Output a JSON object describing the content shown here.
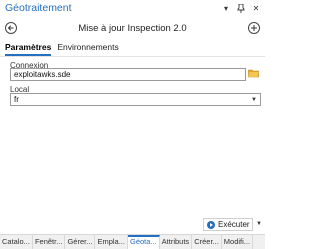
{
  "window": {
    "title": "Géotraitement"
  },
  "title_icons": [
    "dropdown-arrow-icon",
    "pin-icon",
    "close-icon"
  ],
  "tool": {
    "title": "Mise à jour Inspection 2.0"
  },
  "tabs": [
    {
      "label": "Paramètres",
      "active": true
    },
    {
      "label": "Environnements",
      "active": false
    }
  ],
  "params": {
    "connexion": {
      "label": "Connexion",
      "value": "exploitawks.sde"
    },
    "local": {
      "label": "Local",
      "value": "fr"
    }
  },
  "run": {
    "label": "Exécuter"
  },
  "bottom_tabs": [
    {
      "label": "Catalo...",
      "active": false
    },
    {
      "label": "Fenêtr...",
      "active": false
    },
    {
      "label": "Gérer...",
      "active": false
    },
    {
      "label": "Empla...",
      "active": false
    },
    {
      "label": "Géota...",
      "active": true
    },
    {
      "label": "Attributs",
      "active": false
    },
    {
      "label": "Créer...",
      "active": false
    },
    {
      "label": "Modifi...",
      "active": false
    }
  ],
  "colors": {
    "accent": "#2470c0",
    "folder": "#e6a727"
  }
}
